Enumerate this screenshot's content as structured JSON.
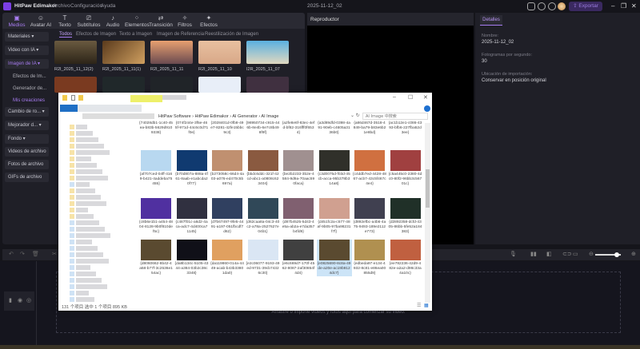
{
  "titlebar": {
    "app_name": "HitPaw Edimakor",
    "menus": [
      "Archivo",
      "Configuración",
      "Ayuda"
    ],
    "project_title": "2025-11-12_02",
    "export_label": "⇪ Exportar",
    "icons": [
      "layout-icon",
      "feedback-icon",
      "download-icon"
    ]
  },
  "toolbar": {
    "tools": [
      {
        "label": "Medios",
        "icon": "▣"
      },
      {
        "label": "Avatar AI",
        "icon": "☺"
      },
      {
        "label": "Texto",
        "icon": "T"
      },
      {
        "label": "Subtítulos",
        "icon": "⎚"
      },
      {
        "label": "Audio",
        "icon": "♪"
      },
      {
        "label": "Elementos",
        "icon": "⁘"
      },
      {
        "label": "Transición",
        "icon": "⇄"
      },
      {
        "label": "Filtros",
        "icon": "✧"
      },
      {
        "label": "Efectos",
        "icon": "✦"
      }
    ],
    "active": "Medios"
  },
  "sidebar": {
    "items": [
      {
        "label": "Materiales ▾"
      },
      {
        "label": "Video con IA ▾"
      },
      {
        "label": "Imagen de IA ▾"
      },
      {
        "label": "Efectos de Im..."
      },
      {
        "label": "Generador de..."
      },
      {
        "label": "Mis creaciones"
      },
      {
        "label": "Cambio de ro... ▾"
      },
      {
        "label": "Mejorador d... ▾"
      },
      {
        "label": "Fondo ▾"
      },
      {
        "label": "Videos de archivo"
      },
      {
        "label": "Fotos de archivo"
      },
      {
        "label": "GIFs de archivo"
      }
    ]
  },
  "content_tabs": [
    "Todos",
    "Efectos de Imagen",
    "Texto a Imagen",
    "Imagen de Referencia",
    "Reestilización de Imagen"
  ],
  "media": [
    "R2I_2025_11_12(2)",
    "R2I_2025_11_11(1)",
    "R2I_2025_11_11",
    "R2I_2025_11_10",
    "I2R_2025_11_07"
  ],
  "player": {
    "title": "Reproductor"
  },
  "details": {
    "tab": "Detalles",
    "name_label": "Nombre:",
    "name_value": "2025-11-12_02",
    "fps_label": "Fotogramas por segundo:",
    "fps_value": "30",
    "import_label": "Ubicación de importación:",
    "import_value": "Conservar en posición original"
  },
  "timeline": {
    "drop_text": "Arrastre o importe videos y fotos aquí para comenzar su video.",
    "zoom_level": 0.85
  },
  "explorer": {
    "breadcrumb": [
      "HitPaw Software",
      "HitPaw Edimakor",
      "AI Generator",
      "AI Image"
    ],
    "search_placeholder": "AI Image 中搜索",
    "status": "131 个项目   选中 1 个项目  895 KB",
    "selected": "{e0825690-8c8a-49de-a20e-ac19b9124dc7}",
    "files": [
      "{74028db1-1c40-45ea-b83b-5629d9109338}",
      "{074f244e-3f5e-465f-971d-44c6c0d71f0e}",
      "{2028401d-0fb8-49e7-8281-42fe15bbc9c3}",
      "{98950734-c915-446b-8e4b-6e7c8b498f9f}",
      "{a2fe8e6f-83ec-4efd-bf82-316fff0f6534}",
      "{a3d89dfd-0398-4a91-90eb-c4605a3136b0}",
      "{a86d467d-3518-4849-ba79-b83e6b21e8bd}",
      "{ac1b12e1-c086-4393-bfb6-227fba52d3ee}",
      "{af707ced-04ff-4169-b421-4addeba75455}",
      "{b70d807a-888a-4f61-8aab-e1abcda20f77}",
      "{b273058c-66d4-4a03-a076-ed470c5b697a}",
      "{bbdc6ddc-321f-42cd-abc1-a0808c623404}",
      "{be2b2233-3b2e-4584-9d9a-70aac590faca}",
      "{c3d0075d-f03d-45cb-acca-95b378b314a8}",
      "{c4ddb7ed-4428-4867-acb7-43c5f467c4e4}",
      "{c5a445c0-2380-4dc0-80f2-96bb3c56701c}",
      "{c8b6e1b1-a454-4804-8128-9b0f810def5c}",
      "{c487f01c-a6d2-4aca-adc7-4d400ca71145}",
      "{d7b67497-9fe5-4491-a197-051fbcdf7d62}",
      "{d62caa8a-04c3-40c2-a78a-2527627e04b1}",
      "{d87b4525-5d43-4e5a-ab2a-e7da357b4fd9}",
      "{d451fc2a-c577-48af-9b05-97ba98231f7f}",
      "{d892efbc-a4b6-4a75-9493-189e2112e773}",
      "{d2892358-dcfd-4305-86bb-5fe52a184383}",
      "{d8060662-8b42-4a58-b77f-3c2536e154ac}",
      "{da8b134c-5105-4344-a384-03b2c38c3348}",
      "{da119860-014a-4449-acab-b43b33801da0}",
      "{e2c06077-9193-49ed-9731-39cb74326c30}",
      "{e6c669d7-170f-4562-8087-2af30854f4d4}",
      "{e0825690-8c8a-49de-a20e-ac19b9124dc7}",
      "{edbeda97-e134-4932-8c81-e86ea00855d9}",
      "{ee782236-42d9-482e-a2a2-d98c33a4a10c}"
    ]
  },
  "colors": {
    "accent": "#a77cf0",
    "export_bg": "#3a2960",
    "selection": "#cce4f7"
  }
}
